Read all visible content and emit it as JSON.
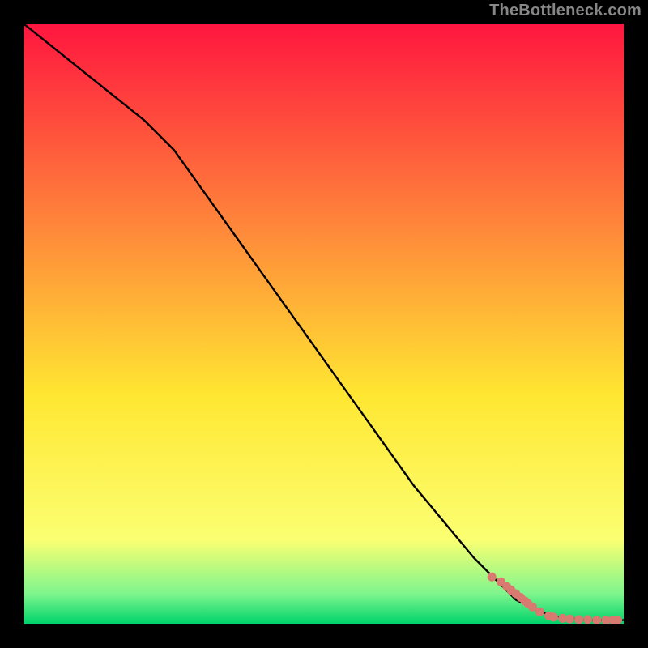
{
  "watermark": "TheBottleneck.com",
  "colors": {
    "page_bg": "#000000",
    "gradient_top": "#ff163f",
    "gradient_mid_upper": "#ff8b3a",
    "gradient_mid": "#ffe732",
    "gradient_mid_lower": "#fbff72",
    "gradient_near_bottom": "#7ef58d",
    "gradient_bottom": "#00d36b",
    "curve": "#000000",
    "scatter": "#d87a6f"
  },
  "chart_data": {
    "type": "line",
    "title": "",
    "xlabel": "",
    "ylabel": "",
    "xlim": [
      0,
      100
    ],
    "ylim": [
      0,
      100
    ],
    "series": [
      {
        "name": "bottleneck-curve",
        "kind": "line",
        "x": [
          0,
          5,
          10,
          15,
          20,
          25,
          30,
          35,
          40,
          45,
          50,
          55,
          60,
          65,
          70,
          75,
          80,
          82,
          84,
          86,
          88,
          90,
          92,
          94,
          96,
          98,
          100
        ],
        "y": [
          100,
          96,
          92,
          88,
          84,
          79,
          72,
          65,
          58,
          51,
          44,
          37,
          30,
          23,
          17,
          11,
          6,
          4,
          3,
          2,
          1.4,
          1,
          0.8,
          0.6,
          0.6,
          0.6,
          0.6
        ]
      },
      {
        "name": "scatter-points",
        "kind": "scatter",
        "x": [
          78,
          79.5,
          80.5,
          81.2,
          82,
          82.8,
          83.5,
          84,
          84.8,
          86,
          87.5,
          88.3,
          89.8,
          91,
          92.5,
          94,
          95.5,
          97,
          98.2,
          99
        ],
        "y": [
          7.8,
          7.0,
          6.2,
          5.6,
          5.0,
          4.4,
          3.8,
          3.4,
          2.8,
          2.0,
          1.3,
          1.1,
          0.9,
          0.8,
          0.7,
          0.7,
          0.6,
          0.6,
          0.6,
          0.6
        ]
      }
    ]
  }
}
